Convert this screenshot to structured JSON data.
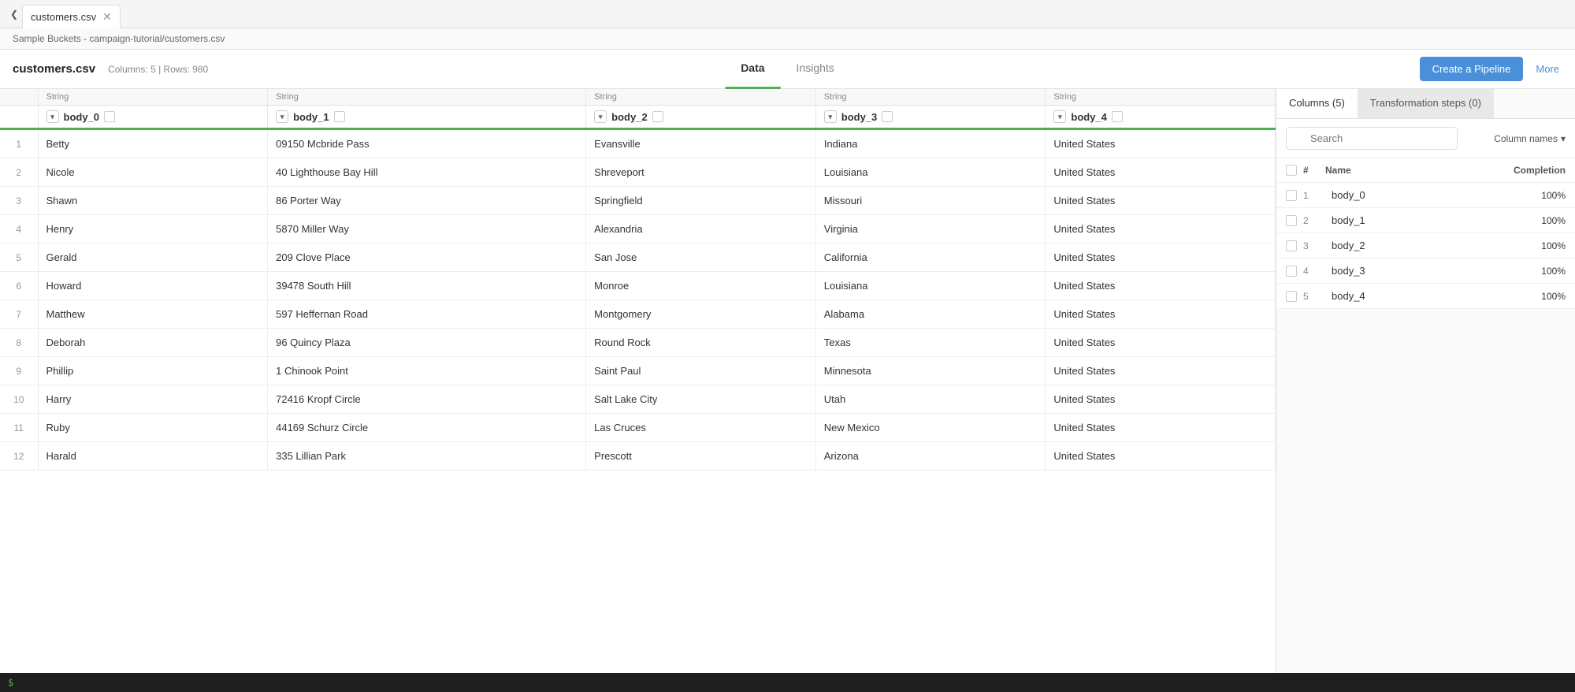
{
  "app": {
    "tab_label": "customers.csv",
    "breadcrumb": "Sample Buckets - campaign-tutorial/customers.csv",
    "file_title": "customers.csv",
    "file_meta": "Columns: 5 | Rows: 980"
  },
  "nav_tabs": [
    {
      "label": "Data",
      "active": true
    },
    {
      "label": "Insights",
      "active": false
    }
  ],
  "header_actions": {
    "create_pipeline": "Create a Pipeline",
    "more": "More"
  },
  "table": {
    "columns": [
      {
        "type": "String",
        "key": "body_0"
      },
      {
        "type": "String",
        "key": "body_1"
      },
      {
        "type": "String",
        "key": "body_2"
      },
      {
        "type": "String",
        "key": "body_3"
      },
      {
        "type": "String",
        "key": "body_4"
      }
    ],
    "rows": [
      {
        "num": 1,
        "body_0": "Betty",
        "body_1": "09150 Mcbride Pass",
        "body_2": "Evansville",
        "body_3": "Indiana",
        "body_4": "United States"
      },
      {
        "num": 2,
        "body_0": "Nicole",
        "body_1": "40 Lighthouse Bay Hill",
        "body_2": "Shreveport",
        "body_3": "Louisiana",
        "body_4": "United States"
      },
      {
        "num": 3,
        "body_0": "Shawn",
        "body_1": "86 Porter Way",
        "body_2": "Springfield",
        "body_3": "Missouri",
        "body_4": "United States"
      },
      {
        "num": 4,
        "body_0": "Henry",
        "body_1": "5870 Miller Way",
        "body_2": "Alexandria",
        "body_3": "Virginia",
        "body_4": "United States"
      },
      {
        "num": 5,
        "body_0": "Gerald",
        "body_1": "209 Clove Place",
        "body_2": "San Jose",
        "body_3": "California",
        "body_4": "United States"
      },
      {
        "num": 6,
        "body_0": "Howard",
        "body_1": "39478 South Hill",
        "body_2": "Monroe",
        "body_3": "Louisiana",
        "body_4": "United States"
      },
      {
        "num": 7,
        "body_0": "Matthew",
        "body_1": "597 Heffernan Road",
        "body_2": "Montgomery",
        "body_3": "Alabama",
        "body_4": "United States"
      },
      {
        "num": 8,
        "body_0": "Deborah",
        "body_1": "96 Quincy Plaza",
        "body_2": "Round Rock",
        "body_3": "Texas",
        "body_4": "United States"
      },
      {
        "num": 9,
        "body_0": "Phillip",
        "body_1": "1 Chinook Point",
        "body_2": "Saint Paul",
        "body_3": "Minnesota",
        "body_4": "United States"
      },
      {
        "num": 10,
        "body_0": "Harry",
        "body_1": "72416 Kropf Circle",
        "body_2": "Salt Lake City",
        "body_3": "Utah",
        "body_4": "United States"
      },
      {
        "num": 11,
        "body_0": "Ruby",
        "body_1": "44169 Schurz Circle",
        "body_2": "Las Cruces",
        "body_3": "New Mexico",
        "body_4": "United States"
      },
      {
        "num": 12,
        "body_0": "Harald",
        "body_1": "335 Lillian Park",
        "body_2": "Prescott",
        "body_3": "Arizona",
        "body_4": "United States"
      }
    ]
  },
  "right_panel": {
    "tab1_label": "Columns (5)",
    "tab2_label": "Transformation steps (0)",
    "search_placeholder": "Search",
    "col_names_btn": "Column names",
    "headers": {
      "num": "#",
      "name": "Name",
      "completion": "Completion"
    },
    "columns": [
      {
        "num": 1,
        "name": "body_0",
        "completion": "100%"
      },
      {
        "num": 2,
        "name": "body_1",
        "completion": "100%"
      },
      {
        "num": 3,
        "name": "body_2",
        "completion": "100%"
      },
      {
        "num": 4,
        "name": "body_3",
        "completion": "100%"
      },
      {
        "num": 5,
        "name": "body_4",
        "completion": "100%"
      }
    ]
  },
  "terminal": {
    "prompt": "$"
  }
}
